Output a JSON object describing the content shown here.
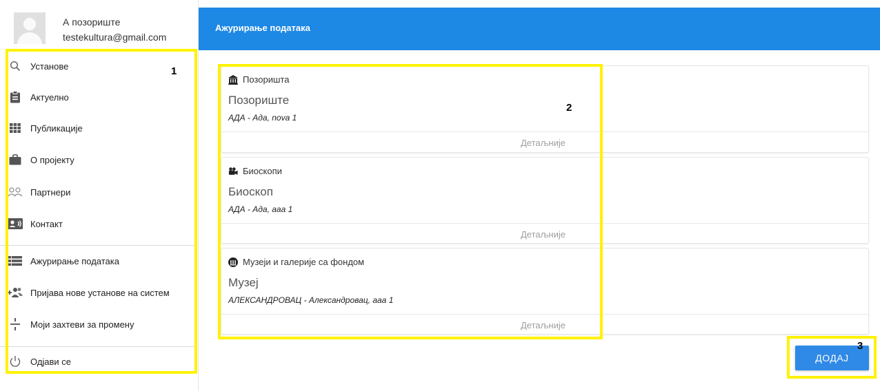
{
  "profile": {
    "name": "А позориште",
    "email": "testekultura@gmail.com"
  },
  "sidebar": {
    "items": [
      {
        "label": "Установе",
        "icon": "search-icon"
      },
      {
        "label": "Актуелно",
        "icon": "clipboard-icon"
      },
      {
        "label": "Публикације",
        "icon": "grid-icon"
      },
      {
        "label": "О пројекту",
        "icon": "briefcase-icon"
      },
      {
        "label": "Партнери",
        "icon": "people-icon"
      },
      {
        "label": "Контакт",
        "icon": "contact-card-icon"
      }
    ],
    "secondary": [
      {
        "label": "Ажурирање података",
        "icon": "list-icon"
      },
      {
        "label": "Пријава нове установе на систем",
        "icon": "group-add-icon"
      },
      {
        "label": "Моји захтеви за промену",
        "icon": "divide-icon"
      }
    ],
    "logout": {
      "label": "Одјави се",
      "icon": "power-icon"
    }
  },
  "header": {
    "title": "Ажурирање података",
    "color": "#1e88e5"
  },
  "cards": [
    {
      "category": "Позоришта",
      "icon": "theater-icon",
      "name": "Позориште",
      "address": "АДА - Ада, nova 1",
      "details": "Детаљније"
    },
    {
      "category": "Биоскопи",
      "icon": "movie-camera-icon",
      "name": "Биоскоп",
      "address": "АДА - Ада, ааа 1",
      "details": "Детаљније"
    },
    {
      "category": "Музеји и галерије са фондом",
      "icon": "museum-icon",
      "name": "Музеј",
      "address": "АЛЕКСАНДРОВАЦ - Александровац, ааа 1",
      "details": "Детаљније"
    }
  ],
  "add_button": {
    "label": "ДОДАЈ"
  },
  "annotations": [
    "1",
    "2",
    "3"
  ]
}
